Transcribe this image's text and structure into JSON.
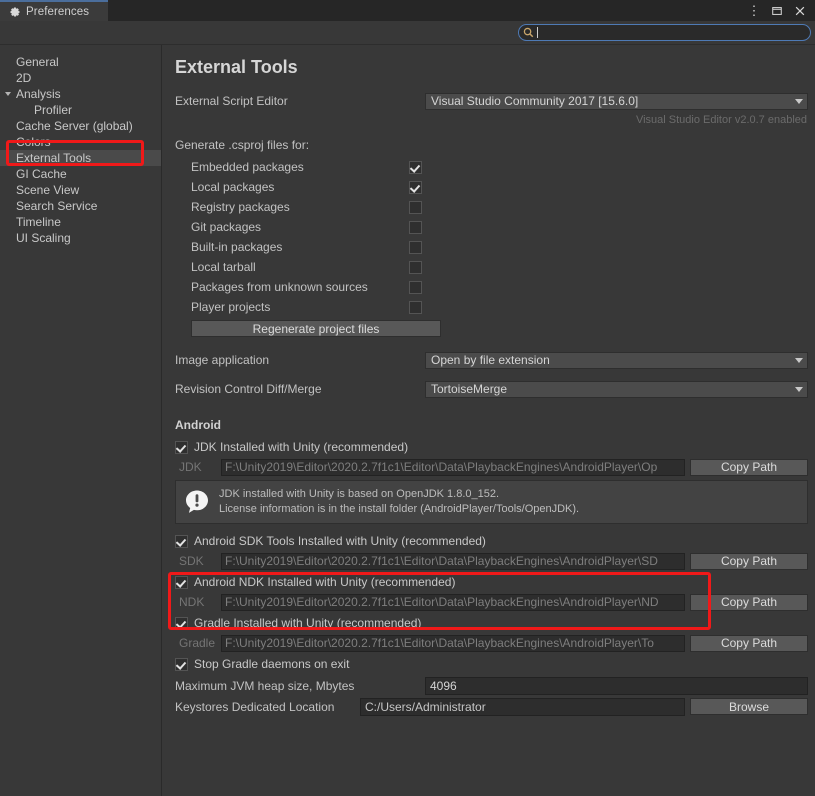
{
  "window": {
    "tab_title": "Preferences",
    "gear_icon": "gear-icon",
    "controls": {
      "menu": "⋮",
      "maximize": "▢",
      "close": "✕"
    }
  },
  "search": {
    "value": "",
    "placeholder": "",
    "icon": "search-icon"
  },
  "sidebar": {
    "items": [
      {
        "label": "General",
        "indent": 0,
        "selected": false,
        "arrow": false
      },
      {
        "label": "2D",
        "indent": 0,
        "selected": false,
        "arrow": false
      },
      {
        "label": "Analysis",
        "indent": 0,
        "selected": false,
        "arrow": true
      },
      {
        "label": "Profiler",
        "indent": 1,
        "selected": false,
        "arrow": false
      },
      {
        "label": "Cache Server (global)",
        "indent": 0,
        "selected": false,
        "arrow": false
      },
      {
        "label": "Colors",
        "indent": 0,
        "selected": false,
        "arrow": false
      },
      {
        "label": "External Tools",
        "indent": 0,
        "selected": true,
        "arrow": false
      },
      {
        "label": "GI Cache",
        "indent": 0,
        "selected": false,
        "arrow": false
      },
      {
        "label": "Scene View",
        "indent": 0,
        "selected": false,
        "arrow": false
      },
      {
        "label": "Search Service",
        "indent": 0,
        "selected": false,
        "arrow": false
      },
      {
        "label": "Timeline",
        "indent": 0,
        "selected": false,
        "arrow": false
      },
      {
        "label": "UI Scaling",
        "indent": 0,
        "selected": false,
        "arrow": false
      }
    ]
  },
  "main": {
    "title": "External Tools",
    "script_editor": {
      "label": "External Script Editor",
      "value": "Visual Studio Community 2017 [15.6.0]",
      "note": "Visual Studio Editor v2.0.7 enabled"
    },
    "csproj": {
      "label": "Generate .csproj files for:",
      "options": [
        {
          "label": "Embedded packages",
          "checked": true
        },
        {
          "label": "Local packages",
          "checked": true
        },
        {
          "label": "Registry packages",
          "checked": false
        },
        {
          "label": "Git packages",
          "checked": false
        },
        {
          "label": "Built-in packages",
          "checked": false
        },
        {
          "label": "Local tarball",
          "checked": false
        },
        {
          "label": "Packages from unknown sources",
          "checked": false
        },
        {
          "label": "Player projects",
          "checked": false
        }
      ],
      "regenerate_button": "Regenerate project files"
    },
    "image_application": {
      "label": "Image application",
      "value": "Open by file extension"
    },
    "revision_control": {
      "label": "Revision Control Diff/Merge",
      "value": "TortoiseMerge"
    },
    "android": {
      "heading": "Android",
      "jdk": {
        "checkbox_label": "JDK Installed with Unity (recommended)",
        "checked": true,
        "path_key": "JDK",
        "path_value": "F:\\Unity2019\\Editor\\2020.2.7f1c1\\Editor\\Data\\PlaybackEngines\\AndroidPlayer\\Op",
        "copy_button": "Copy Path",
        "info_icon": "info-exclamation-icon",
        "info_line1": "JDK installed with Unity is based on OpenJDK 1.8.0_152.",
        "info_line2": "License information is in the install folder (AndroidPlayer/Tools/OpenJDK)."
      },
      "sdk": {
        "checkbox_label": "Android SDK Tools Installed with Unity (recommended)",
        "checked": true,
        "path_key": "SDK",
        "path_value": "F:\\Unity2019\\Editor\\2020.2.7f1c1\\Editor\\Data\\PlaybackEngines\\AndroidPlayer\\SD",
        "copy_button": "Copy Path"
      },
      "ndk": {
        "checkbox_label": "Android NDK Installed with Unity (recommended)",
        "checked": true,
        "path_key": "NDK",
        "path_value": "F:\\Unity2019\\Editor\\2020.2.7f1c1\\Editor\\Data\\PlaybackEngines\\AndroidPlayer\\ND",
        "copy_button": "Copy Path"
      },
      "gradle": {
        "checkbox_label": "Gradle Installed with Unity (recommended)",
        "checked": true,
        "path_key": "Gradle",
        "path_value": "F:\\Unity2019\\Editor\\2020.2.7f1c1\\Editor\\Data\\PlaybackEngines\\AndroidPlayer\\To",
        "copy_button": "Copy Path"
      },
      "stop_daemons": {
        "label": "Stop Gradle daemons on exit",
        "checked": true
      },
      "jvm_heap": {
        "label": "Maximum JVM heap size, Mbytes",
        "value": "4096"
      },
      "keystores": {
        "label": "Keystores Dedicated Location",
        "value": "C:/Users/Administrator",
        "browse_button": "Browse"
      }
    }
  },
  "annotations": {
    "accent_color": "#f01919",
    "highlight_sidebar": "External Tools",
    "highlight_gradle": "Gradle Installed with Unity (recommended)"
  }
}
